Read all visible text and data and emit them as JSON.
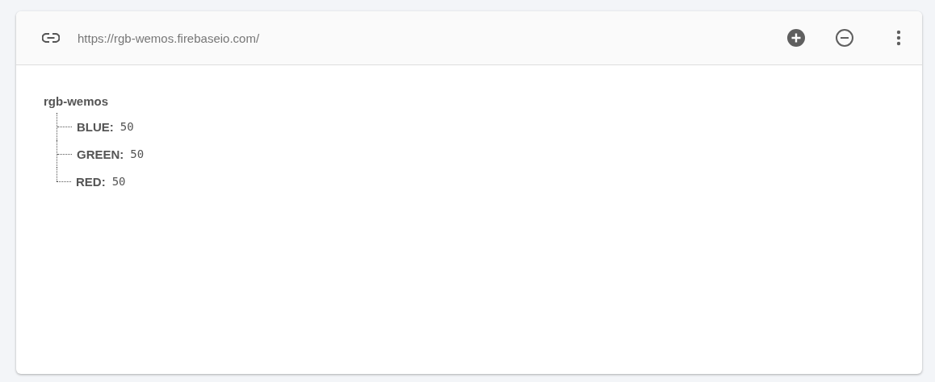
{
  "toolbar": {
    "url": "https://rgb-wemos.firebaseio.com/"
  },
  "tree": {
    "key": "rgb-wemos",
    "children": [
      {
        "key": "BLUE:",
        "value": "50"
      },
      {
        "key": "GREEN:",
        "value": "50"
      },
      {
        "key": "RED:",
        "value": "50"
      }
    ]
  }
}
